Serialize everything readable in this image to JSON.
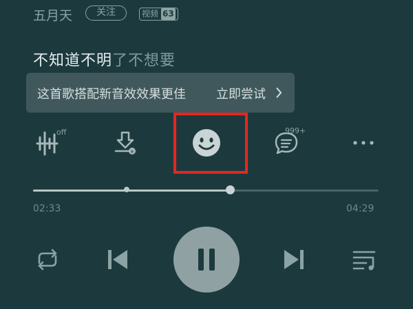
{
  "header": {
    "artist": "五月天",
    "follow_label": "关注",
    "video_label": "视频",
    "video_count": "63"
  },
  "lyric": {
    "sung": "不知道不明",
    "unsung": "了不想要"
  },
  "tooltip": {
    "message": "这首歌搭配新音效效果更佳",
    "action": "立即尝试"
  },
  "actions": {
    "sound_effect_badge": "off",
    "comment_count": "999+",
    "icons": [
      "sound-effect-icon",
      "download-icon",
      "emoji-face-icon",
      "comment-icon",
      "more-icon"
    ]
  },
  "progress": {
    "current": "02:33",
    "total": "04:29",
    "played_fraction": 0.57
  },
  "controls": {
    "icons": [
      "repeat-icon",
      "previous-icon",
      "pause-icon",
      "next-icon",
      "playlist-icon"
    ]
  },
  "colors": {
    "background": "#1c3a3e",
    "highlight": "#e8251f",
    "tooltip": "#40585b"
  }
}
